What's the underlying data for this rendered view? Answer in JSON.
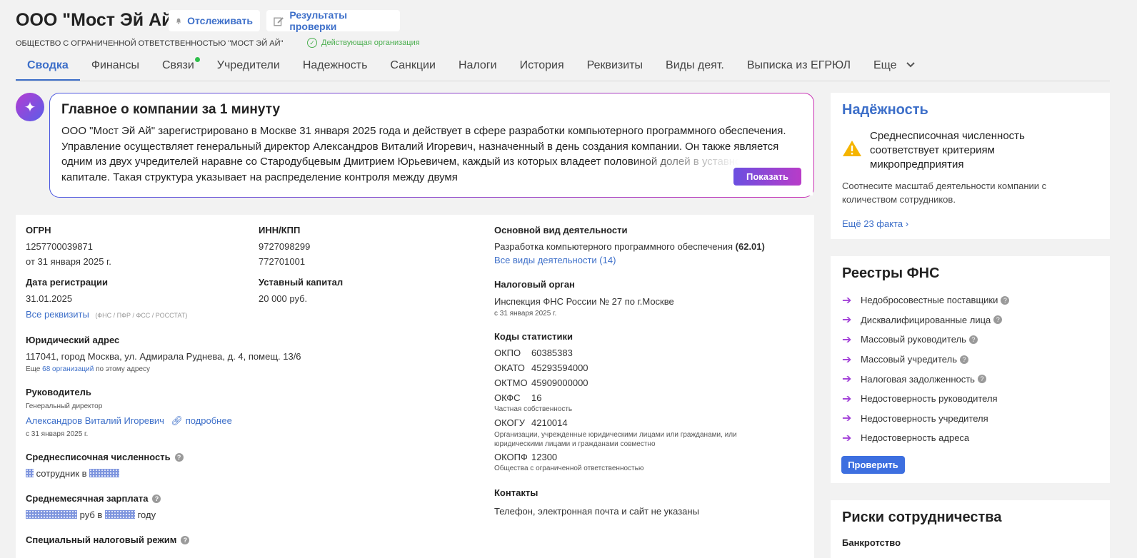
{
  "header": {
    "title": "ООО \"Мост Эй Ай\"",
    "track_label": "Отслеживать",
    "check_results_label": "Результаты проверки",
    "full_name": "ОБЩЕСТВО С ОГРАНИЧЕННОЙ ОТВЕТСТВЕННОСТЬЮ \"МОСТ ЭЙ АЙ\"",
    "status": "Действующая организация"
  },
  "tabs": [
    {
      "label": "Сводка",
      "active": true
    },
    {
      "label": "Финансы"
    },
    {
      "label": "Связи",
      "has_dot": true
    },
    {
      "label": "Учредители"
    },
    {
      "label": "Надежность"
    },
    {
      "label": "Санкции"
    },
    {
      "label": "Налоги"
    },
    {
      "label": "История"
    },
    {
      "label": "Реквизиты"
    },
    {
      "label": "Виды деят."
    },
    {
      "label": "Выписка из ЕГРЮЛ"
    },
    {
      "label": "Еще"
    }
  ],
  "summary": {
    "title": "Главное о компании за 1 минуту",
    "text": "ООО \"Мост Эй Ай\" зарегистрировано в Москве 31 января 2025 года и действует в сфере разработки компьютерного программного обеспечения. Управление осуществляет генеральный директор Александров Виталий Игоревич, назначенный в день создания компании. Он также является одним из двух учредителей наравне со Стародубцевым Дмитрием Юрьевичем, каждый из которых владеет половиной долей в уставном капитале. Такая структура указывает на распределение контроля между двумя",
    "show_label": "Показать"
  },
  "details": {
    "ogrn_label": "ОГРН",
    "ogrn": "1257700039871",
    "ogrn_date": "от 31 января 2025 г.",
    "inn_label": "ИНН/КПП",
    "inn": "9727098299",
    "kpp": "772701001",
    "reg_date_label": "Дата регистрации",
    "reg_date": "31.01.2025",
    "capital_label": "Уставный капитал",
    "capital": "20 000 руб.",
    "all_requisites": "Все реквизиты",
    "requisites_sources": "(ФНС / ПФР / ФСС / РОССТАТ)",
    "address_label": "Юридический адрес",
    "address": "117041, город Москва, ул. Адмирала Руднева, д. 4, помещ. 13/6",
    "address_more_prefix": "Еще",
    "address_more_link": "68 организаций",
    "address_more_suffix": "по этому адресу",
    "head_label": "Руководитель",
    "head_position": "Генеральный директор",
    "head_name": "Александров Виталий Игоревич",
    "head_more": "подробнее",
    "head_since": "с 31 января 2025 г.",
    "employees_label": "Среднесписочная численность",
    "employees_text1": "сотрудник в",
    "salary_label": "Среднемесячная зарплата",
    "salary_text1": "руб в",
    "salary_text2": "году",
    "tax_regime_label": "Специальный налоговый режим"
  },
  "activity": {
    "main_label": "Основной вид деятельности",
    "main_text": "Разработка компьютерного программного обеспечения",
    "main_code": "(62.01)",
    "all_link": "Все виды деятельности (14)",
    "tax_label": "Налоговый орган",
    "tax_text": "Инспекция ФНС России № 27 по г.Москве",
    "tax_since": "с 31 января 2025 г.",
    "stat_label": "Коды статистики",
    "codes": [
      {
        "k": "ОКПО",
        "v": "60385383",
        "note": ""
      },
      {
        "k": "ОКАТО",
        "v": "45293594000",
        "note": ""
      },
      {
        "k": "ОКТМО",
        "v": "45909000000",
        "note": ""
      },
      {
        "k": "ОКФС",
        "v": "16",
        "note": "Частная собственность"
      },
      {
        "k": "ОКОГУ",
        "v": "4210014",
        "note": "Организации, учрежденные юридическими лицами или гражданами, или юридическими лицами и гражданами совместно"
      },
      {
        "k": "ОКОПФ",
        "v": "12300",
        "note": "Общества с ограниченной ответственностью"
      }
    ],
    "contacts_label": "Контакты",
    "contacts_text": "Телефон, электронная почта и сайт не указаны"
  },
  "reliability": {
    "title": "Надёжность",
    "fact": "Среднесписочная численность соответствует критериям микропредприятия",
    "note": "Соотнесите масштаб деятельности компании с количеством сотрудников.",
    "more": "Ещё 23 факта"
  },
  "fns": {
    "title": "Реестры ФНС",
    "items": [
      {
        "label": "Недобросовестные поставщики",
        "q": true
      },
      {
        "label": "Дисквалифицированные лица",
        "q": true
      },
      {
        "label": "Массовый руководитель",
        "q": true
      },
      {
        "label": "Массовый учредитель",
        "q": true
      },
      {
        "label": "Налоговая задолженность",
        "q": true
      },
      {
        "label": "Недостоверность руководителя",
        "q": false
      },
      {
        "label": "Недостоверность учредителя",
        "q": false
      },
      {
        "label": "Недостоверность адреса",
        "q": false
      }
    ],
    "check_label": "Проверить"
  },
  "risks": {
    "title": "Риски сотрудничества",
    "bankruptcy": "Банкротство"
  },
  "colors": {
    "accent": "#3d6fc9",
    "active_status": "#4caf50",
    "warning": "#f5b400",
    "arrow": "#a240d8"
  }
}
